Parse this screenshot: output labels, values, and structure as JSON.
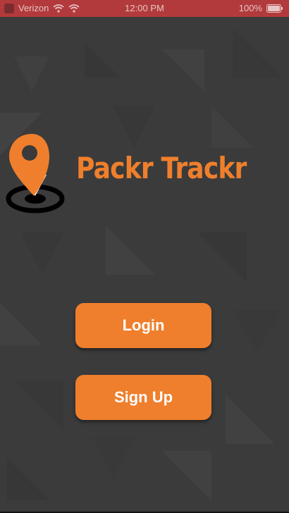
{
  "status_bar": {
    "carrier": "Verizon",
    "time": "12:00 PM",
    "battery": "100%",
    "wifi_icon": "wifi-icon",
    "battery_icon": "battery-icon"
  },
  "branding": {
    "title": "Packr Trackr",
    "logo_icon": "location-pin-icon",
    "accent_color": "#ef7f2c"
  },
  "actions": {
    "login_label": "Login",
    "signup_label": "Sign Up"
  }
}
